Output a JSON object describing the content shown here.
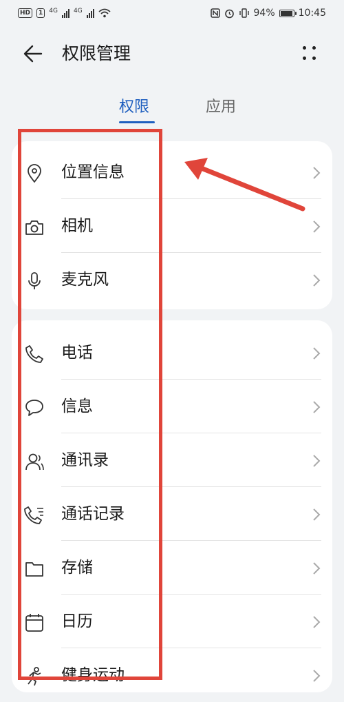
{
  "status_bar": {
    "battery": "94%",
    "time": "10:45",
    "net1": "4G",
    "net2": "4G",
    "hd": "HD",
    "sim": "1"
  },
  "header": {
    "title": "权限管理"
  },
  "tabs": [
    {
      "label": "权限",
      "active": true
    },
    {
      "label": "应用",
      "active": false
    }
  ],
  "groups": [
    {
      "items": [
        {
          "label": "位置信息",
          "icon": "location-icon"
        },
        {
          "label": "相机",
          "icon": "camera-icon"
        },
        {
          "label": "麦克风",
          "icon": "microphone-icon"
        }
      ]
    },
    {
      "items": [
        {
          "label": "电话",
          "icon": "phone-icon"
        },
        {
          "label": "信息",
          "icon": "message-icon"
        },
        {
          "label": "通讯录",
          "icon": "contacts-icon"
        },
        {
          "label": "通话记录",
          "icon": "call-log-icon"
        },
        {
          "label": "存储",
          "icon": "folder-icon"
        },
        {
          "label": "日历",
          "icon": "calendar-icon"
        },
        {
          "label": "健身运动",
          "icon": "fitness-icon"
        }
      ]
    }
  ],
  "colors": {
    "accent": "#1f5fbf",
    "annotation": "#e0453a",
    "background": "#f1f3f5"
  }
}
